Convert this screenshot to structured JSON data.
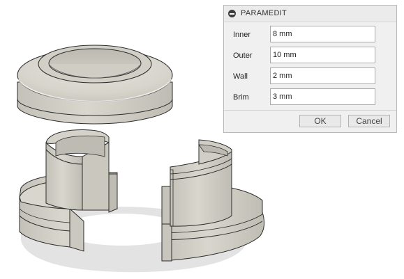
{
  "dialog": {
    "title": "PARAMEDIT",
    "params": [
      {
        "label": "Inner",
        "value": "8 mm"
      },
      {
        "label": "Outer",
        "value": "10 mm"
      },
      {
        "label": "Wall",
        "value": "2 mm"
      },
      {
        "label": "Brim",
        "value": "3 mm"
      }
    ],
    "ok_label": "OK",
    "cancel_label": "Cancel"
  },
  "colors": {
    "body_fill": "#d6d4cb",
    "body_shade": "#bebcb1",
    "edge": "#2b2b2b",
    "ground_shadow": "#e2e2e2"
  }
}
